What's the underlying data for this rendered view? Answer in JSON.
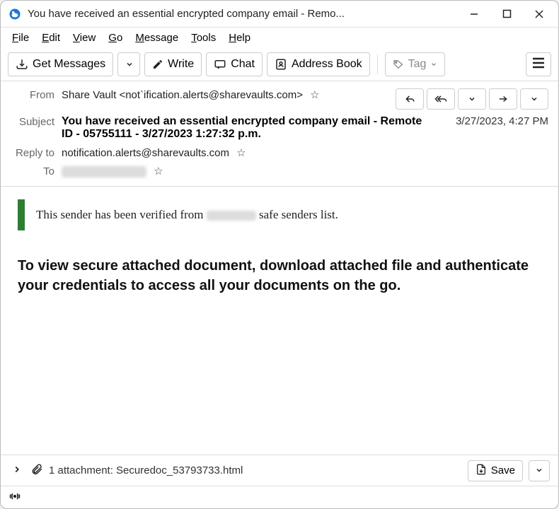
{
  "window": {
    "title": "You have received an essential encrypted company email - Remo..."
  },
  "menu": {
    "file": "File",
    "edit": "Edit",
    "view": "View",
    "go": "Go",
    "message": "Message",
    "tools": "Tools",
    "help": "Help"
  },
  "toolbar": {
    "get_messages": "Get Messages",
    "write": "Write",
    "chat": "Chat",
    "address_book": "Address Book",
    "tag": "Tag"
  },
  "headers": {
    "from_label": "From",
    "from_value": "Share Vault <not`ification.alerts@sharevaults.com>",
    "subject_label": "Subject",
    "subject_value": "You have received an essential encrypted company email - Remote ID - 05755111 - 3/27/2023 1:27:32 p.m.",
    "date": "3/27/2023, 4:27 PM",
    "reply_to_label": "Reply to",
    "reply_to_value": "notification.alerts@sharevaults.com",
    "to_label": "To"
  },
  "body": {
    "verify_prefix": "This sender has been verified from ",
    "verify_suffix": " safe senders list.",
    "main": "To view secure attached document, download attached file and authenticate your credentials to access all your documents on the go."
  },
  "attachment": {
    "text": "1 attachment: Securedoc_53793733.html",
    "save": "Save"
  }
}
